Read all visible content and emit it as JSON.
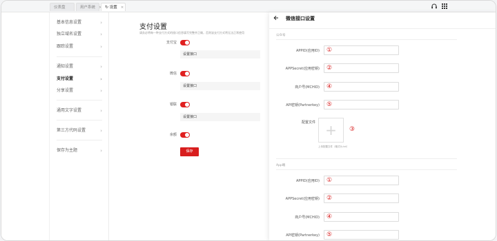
{
  "tabs": [
    {
      "label": "仪表盘",
      "closable": false,
      "active": false
    },
    {
      "label": "用户系统",
      "closable": true,
      "active": false
    },
    {
      "label": "设置",
      "closable": true,
      "active": true,
      "icon": "refresh-icon"
    }
  ],
  "top_icons": [
    "headset-icon",
    "grid-icon"
  ],
  "sidebar": {
    "items": [
      {
        "label": "基本信息设置"
      },
      {
        "label": "独立域名设置"
      },
      {
        "label": "跟踪设置"
      },
      {
        "label": "通知设置"
      },
      {
        "label": "支付设置",
        "active": true
      },
      {
        "label": "分享设置"
      },
      {
        "label": "通用文字设置"
      },
      {
        "label": "第三方代码设置"
      },
      {
        "label": "保存为主题"
      }
    ]
  },
  "main": {
    "title": "支付设置",
    "description": "请务必将每一种支付方式的接口信息填写完整并正确，否则该支付方式将无法正常使用",
    "methods": [
      {
        "label": "支付宝",
        "enabled": true,
        "button": "设置接口"
      },
      {
        "label": "微信",
        "enabled": true,
        "button": "设置接口"
      },
      {
        "label": "银联",
        "enabled": true,
        "button": "设置接口"
      },
      {
        "label": "余额",
        "enabled": true
      }
    ],
    "save_label": "保存"
  },
  "drawer": {
    "title": "微信接口设置",
    "sections": [
      {
        "title": "公众号",
        "fields": [
          {
            "label": "APPID(应用ID)",
            "badge": "①"
          },
          {
            "label": "APPSecret(应用密钥)",
            "badge": "②"
          },
          {
            "label": "商户号(MCHID)",
            "badge": "④"
          },
          {
            "label": "API密钥(Partnerkey)",
            "badge": "⑤"
          }
        ],
        "upload": {
          "label": "配置文件",
          "hint": "上传配置文件（格式为.txt）",
          "badge": "③"
        }
      },
      {
        "title": "App端",
        "fields": [
          {
            "label": "APPID(应用ID)",
            "badge": "①"
          },
          {
            "label": "APPSecret(应用密钥)",
            "badge": "②"
          },
          {
            "label": "商户号(MCHID)",
            "badge": "④"
          },
          {
            "label": "API密钥(Partnerkey)",
            "badge": "⑤"
          }
        ]
      }
    ]
  },
  "colors": {
    "accent": "#d81e1e",
    "badge": "#d81e1e"
  }
}
